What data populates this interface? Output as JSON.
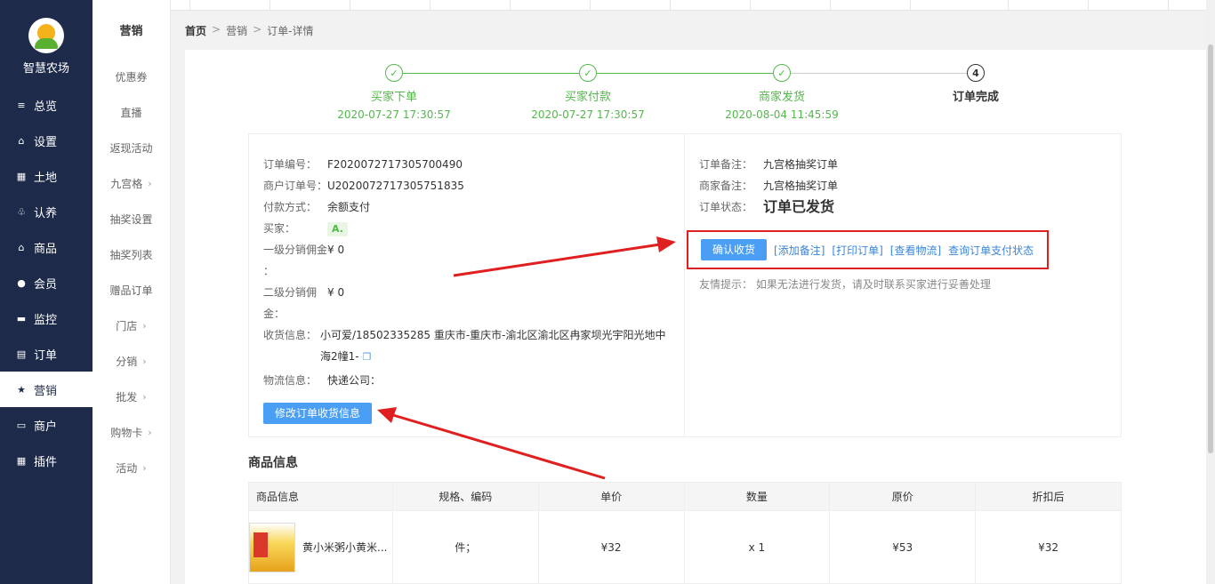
{
  "app": {
    "name": "智慧农场"
  },
  "sidebar": {
    "items": [
      {
        "icon": "sliders-icon",
        "glyph": "≡",
        "label": "总览",
        "active": false
      },
      {
        "icon": "bag-icon",
        "glyph": "⌂",
        "label": "设置",
        "active": false
      },
      {
        "icon": "grid-icon",
        "glyph": "▦",
        "label": "土地",
        "active": false
      },
      {
        "icon": "tree-icon",
        "glyph": "♧",
        "label": "认养",
        "active": false
      },
      {
        "icon": "bag-icon",
        "glyph": "⌂",
        "label": "商品",
        "active": false
      },
      {
        "icon": "user-icon",
        "glyph": "●",
        "label": "会员",
        "active": false
      },
      {
        "icon": "camera-icon",
        "glyph": "▬",
        "label": "监控",
        "active": false
      },
      {
        "icon": "doc-icon",
        "glyph": "▤",
        "label": "订单",
        "active": false
      },
      {
        "icon": "star-icon",
        "glyph": "★",
        "label": "营销",
        "active": true
      },
      {
        "icon": "store-icon",
        "glyph": "▭",
        "label": "商户",
        "active": false
      },
      {
        "icon": "plugin-icon",
        "glyph": "▦",
        "label": "插件",
        "active": false
      }
    ]
  },
  "subnav": {
    "title": "营销",
    "items": [
      {
        "label": "优惠券",
        "arrow": false
      },
      {
        "label": "直播",
        "arrow": false
      },
      {
        "label": "返现活动",
        "arrow": false
      },
      {
        "label": "九宫格",
        "arrow": true
      },
      {
        "label": "抽奖设置",
        "arrow": false
      },
      {
        "label": "抽奖列表",
        "arrow": false
      },
      {
        "label": "赠品订单",
        "arrow": false
      },
      {
        "label": "门店",
        "arrow": true
      },
      {
        "label": "分销",
        "arrow": true
      },
      {
        "label": "批发",
        "arrow": true
      },
      {
        "label": "购物卡",
        "arrow": true
      },
      {
        "label": "活动",
        "arrow": true
      }
    ]
  },
  "breadcrumb": {
    "home": "首页",
    "section": "营销",
    "page": "订单-详情",
    "sep": ">"
  },
  "steps": [
    {
      "label": "买家下单",
      "time": "2020-07-27 17:30:57",
      "done": true
    },
    {
      "label": "买家付款",
      "time": "2020-07-27 17:30:57",
      "done": true
    },
    {
      "label": "商家发货",
      "time": "2020-08-04 11:45:59",
      "done": true
    },
    {
      "label": "订单完成",
      "time": "",
      "done": false,
      "num": "4"
    }
  ],
  "order": {
    "order_no_label": "订单编号：",
    "order_no": "F2020072717305700490",
    "merchant_no_label": "商户订单号：",
    "merchant_no": "U2020072717305751835",
    "pay_label": "付款方式：",
    "pay": "余额支付",
    "buyer_label": "买家：",
    "buyer": "A.",
    "commission1_label": "一级分销佣金",
    "commission1": "¥ 0",
    "commission1_colon": "：",
    "commission2_label": "二级分销佣",
    "commission2": "¥ 0",
    "commission2_tail": "金：",
    "address_label": "收货信息：",
    "address": "小可爱/18502335285 重庆市-重庆市-渝北区渝北区冉家坝光宇阳光地中海2幢1-",
    "logistics_label": "物流信息：",
    "logistics": "快递公司：",
    "edit_button": "修改订单收货信息"
  },
  "order_right": {
    "remark_label": "订单备注：",
    "remark": "九宫格抽奖订单",
    "merchant_remark_label": "商家备注：",
    "merchant_remark": "九宫格抽奖订单",
    "status_label": "订单状态：",
    "status": "订单已发货",
    "confirm_button": "确认收货",
    "links": [
      "[添加备注]",
      "[打印订单]",
      "[查看物流]",
      "查询订单支付状态"
    ],
    "tip": "友情提示： 如果无法进行发货，请及时联系买家进行妥善处理"
  },
  "goods": {
    "title": "商品信息",
    "headers": [
      "商品信息",
      "规格、编码",
      "单价",
      "数量",
      "原价",
      "折扣后"
    ],
    "rows": [
      {
        "name": "黄小米粥小黄米...",
        "spec": "件；",
        "price": "¥32",
        "qty": "x 1",
        "orig": "¥53",
        "disc": "¥32"
      }
    ]
  },
  "colors": {
    "accent": "#4a9ff5",
    "success": "#52b84a",
    "status": "#f5a623",
    "annotation": "#e02020",
    "sidebar": "#1d2a4a"
  }
}
